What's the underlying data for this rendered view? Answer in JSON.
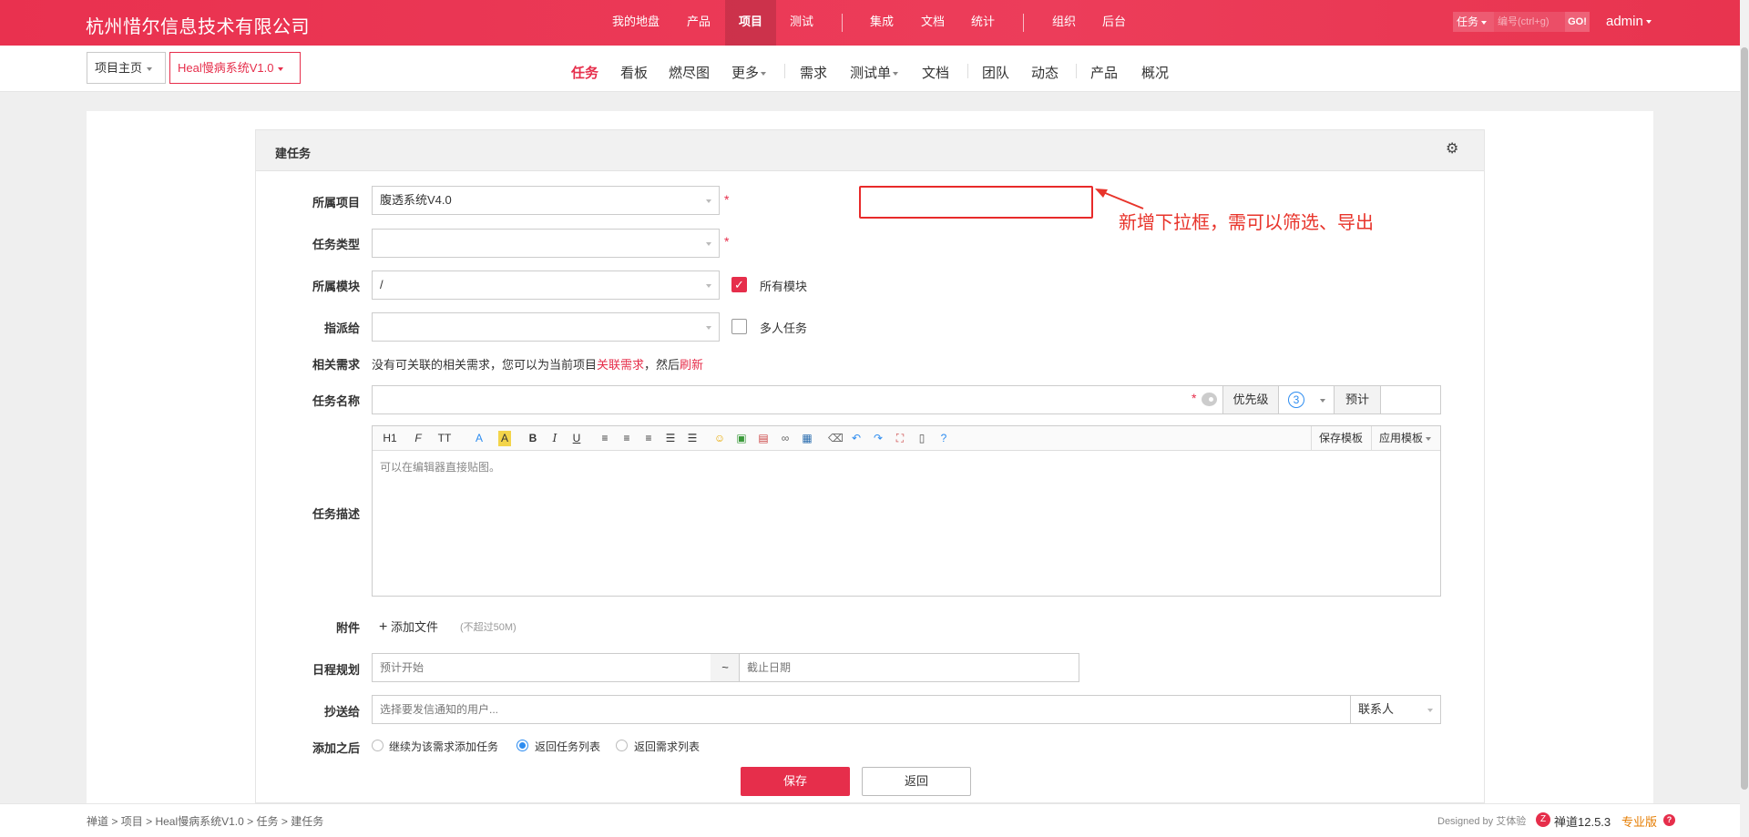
{
  "header": {
    "brand": "杭州惜尔信息技术有限公司",
    "nav": [
      {
        "label": "我的地盘"
      },
      {
        "label": "产品"
      },
      {
        "label": "项目"
      },
      {
        "label": "测试"
      },
      {
        "label": "集成"
      },
      {
        "label": "文档"
      },
      {
        "label": "统计"
      },
      {
        "label": "组织"
      },
      {
        "label": "后台"
      }
    ],
    "active_nav": "项目",
    "search": {
      "type": "任务",
      "placeholder": "编号(ctrl+g)",
      "go": "GO!"
    },
    "user": "admin"
  },
  "subheader": {
    "crumb_home": "项目主页",
    "crumb_project": "Heal慢病系统V1.0",
    "nav": [
      {
        "label": "任务"
      },
      {
        "label": "看板"
      },
      {
        "label": "燃尽图"
      },
      {
        "label": "更多"
      },
      {
        "label": "需求"
      },
      {
        "label": "测试单"
      },
      {
        "label": "文档"
      },
      {
        "label": "团队"
      },
      {
        "label": "动态"
      },
      {
        "label": "产品"
      },
      {
        "label": "概况"
      }
    ]
  },
  "form": {
    "title": "建任务",
    "project_label": "所属项目",
    "project_value": "腹透系统V4.0",
    "type_label": "任务类型",
    "type_value": "",
    "module_label": "所属模块",
    "module_value": "/",
    "all_modules_label": "所有模块",
    "all_modules_checked": true,
    "assign_label": "指派给",
    "assign_value": "",
    "multi_label": "多人任务",
    "multi_checked": false,
    "story_label": "相关需求",
    "story_text_1": "没有可关联的相关需求，您可以为当前项目",
    "story_link_1": "关联需求",
    "story_text_2": "，然后",
    "story_link_2": "刷新",
    "name_label": "任务名称",
    "priority_label": "优先级",
    "priority_value": "3",
    "estimate_label": "预计",
    "desc_label": "任务描述",
    "desc_placeholder": "可以在编辑器直接贴图。",
    "editor_tools": [
      "H1",
      "F",
      "TT",
      "A",
      "A",
      "B",
      "I",
      "U"
    ],
    "save_template": "保存模板",
    "apply_template": "应用模板",
    "attach_label": "附件",
    "attach_button": "添加文件",
    "attach_hint": "(不超过50M)",
    "schedule_label": "日程规划",
    "start_placeholder": "预计开始",
    "tilde": "~",
    "end_placeholder": "截止日期",
    "cc_label": "抄送给",
    "cc_placeholder": "选择要发信通知的用户...",
    "contacts_label": "联系人",
    "after_label": "添加之后",
    "after_options": [
      {
        "label": "继续为该需求添加任务",
        "checked": false
      },
      {
        "label": "返回任务列表",
        "checked": true
      },
      {
        "label": "返回需求列表",
        "checked": false
      }
    ],
    "save_button": "保存",
    "back_button": "返回"
  },
  "annotation": {
    "text": "新增下拉框，需可以筛选、导出",
    "color": "#e8342b"
  },
  "footer": {
    "breadcrumb": [
      "禅道",
      "项目",
      "Heal慢病系统V1.0",
      "任务",
      "建任务"
    ],
    "sep": ">",
    "designed_by": "Designed by 艾体验",
    "version": "禅道12.5.3",
    "edition": "专业版"
  },
  "colors": {
    "accent": "#e62e4b",
    "header": "#e9314f",
    "link": "#2d8cf0"
  }
}
